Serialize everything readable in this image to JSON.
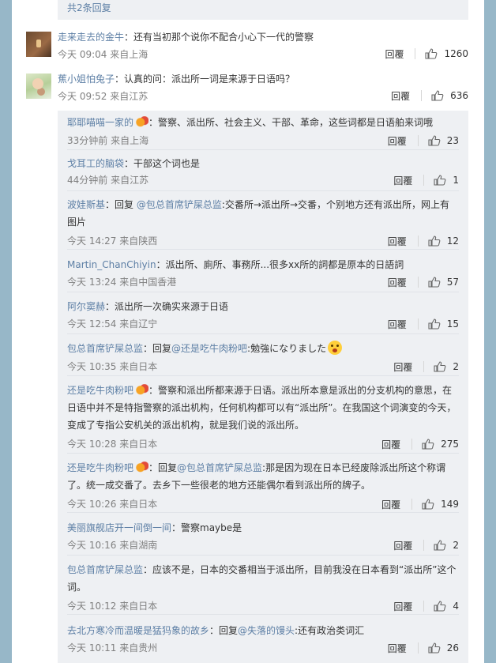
{
  "more_replies": "共2条回复",
  "reply_label": "回覆",
  "top_comments": [
    {
      "username": "走来走去的金牛",
      "text": "：还有当初那个说你不配合小心下一代的警察",
      "time": "今天 09:04 来自上海",
      "likes": "1260"
    },
    {
      "username": "蕉小姐怕兔子",
      "text": "：认真的问：派出所一词是来源于日语吗？",
      "time": "今天 09:52 来自江苏",
      "likes": "636"
    }
  ],
  "sub_comments": [
    {
      "username": "耶耶喵喵一家的",
      "text": "：警察、派出所、社会主义、干部、革命，这些词都是日语舶来词哦",
      "time": "33分钟前 来自上海",
      "likes": "23"
    },
    {
      "username": "戈耳工的脑袋",
      "text": "：干部这个词也是",
      "time": "44分钟前 来自江苏",
      "likes": "1"
    },
    {
      "username": "波娃斯基",
      "reply_prefix": "：回复",
      "reply_to": "@包总首席铲屎总监",
      "text": ":交番所→派出所→交番，个别地方还有派出所，网上有图片",
      "time": "今天 14:27 来自陕西",
      "likes": "12"
    },
    {
      "username": "Martin_ChanChiyin",
      "text": "：派出所、廁所、事務所...很多xx所的詞都是原本的日語詞",
      "time": "今天 13:24 来自中国香港",
      "likes": "57"
    },
    {
      "username": "阿尔窦赫",
      "text": "：派出所一次确实来源于日语",
      "time": "今天 12:54 来自辽宁",
      "likes": "15"
    },
    {
      "username": "包总首席铲屎总监",
      "reply_prefix": "：回复",
      "reply_to": "@还是吃牛肉粉吧",
      "text": ":勉強になりました",
      "time": "今天 10:35 来自日本",
      "likes": "2"
    },
    {
      "username": "还是吃牛肉粉吧",
      "text": "：警察和派出所都来源于日语。派出所本意是派出的分支机构的意思，在日语中并不是特指警察的派出机构，任何机构都可以有“派出所”。在我国这个词演变的今天，变成了专指公安机关的派出机构，就是我们说的派出所。",
      "time": "今天 10:28 来自日本",
      "likes": "275"
    },
    {
      "username": "还是吃牛肉粉吧",
      "reply_prefix": "：回复",
      "reply_to": "@包总首席铲屎总监",
      "text": ":那是因为现在日本已经废除派出所这个称谓了。统一成交番了。去乡下一些很老的地方还能偶尔看到派出所的牌子。",
      "time": "今天 10:26 来自日本",
      "likes": "149"
    },
    {
      "username": "美丽旗舰店开一间倒一间",
      "text": "：警察maybe是",
      "time": "今天 10:16 来自湖南",
      "likes": "2"
    },
    {
      "username": "包总首席铲屎总监",
      "text": "：应该不是，日本的交番相当于派出所，目前我没在日本看到“派出所”这个词。",
      "time": "今天 10:12 来自日本",
      "likes": "4"
    },
    {
      "username": "去北方寒冷而温暖是猛犸象的故乡",
      "reply_prefix": "：回复",
      "reply_to": "@失落的馒头",
      "text": ":还有政治类词汇",
      "time": "今天 10:11 来自贵州",
      "likes": "26"
    }
  ]
}
